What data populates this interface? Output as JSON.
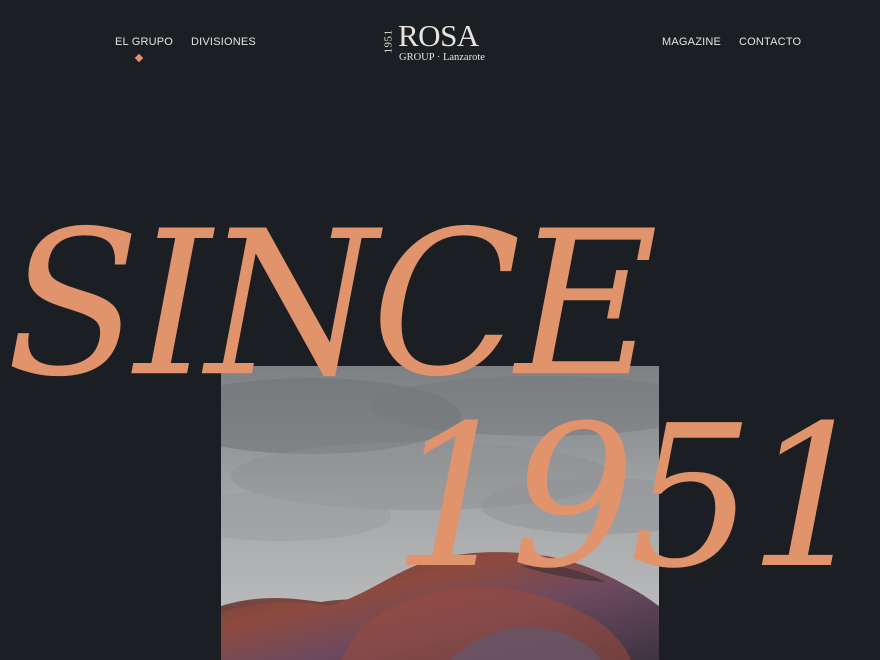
{
  "nav": {
    "left": [
      {
        "label": "EL GRUPO",
        "active": true
      },
      {
        "label": "DIVISIONES",
        "active": false
      }
    ],
    "right": [
      {
        "label": "MAGAZINE",
        "active": false
      },
      {
        "label": "CONTACTO",
        "active": false
      }
    ]
  },
  "logo": {
    "year": "1951",
    "name": "ROSA",
    "subtitle": "GROUP · Lanzarote"
  },
  "hero": {
    "line1": "SINCE",
    "line2": "1951"
  },
  "colors": {
    "background": "#1b1f23",
    "accent": "#e1936b",
    "text": "#e7e3dc"
  }
}
